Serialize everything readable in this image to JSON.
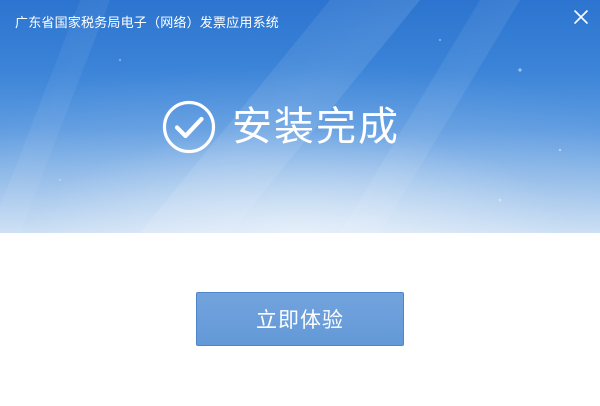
{
  "window": {
    "title": "广东省国家税务局电子（网络）发票应用系统"
  },
  "banner": {
    "status_text": "安装完成",
    "icon": "check-circle-icon"
  },
  "actions": {
    "primary_label": "立即体验"
  },
  "colors": {
    "banner_top": "#2c74cf",
    "banner_bottom": "#c9ddf3",
    "button": "#6399d8",
    "button_border": "#4f86c8",
    "text_on_accent": "#ffffff",
    "background": "#ffffff"
  }
}
